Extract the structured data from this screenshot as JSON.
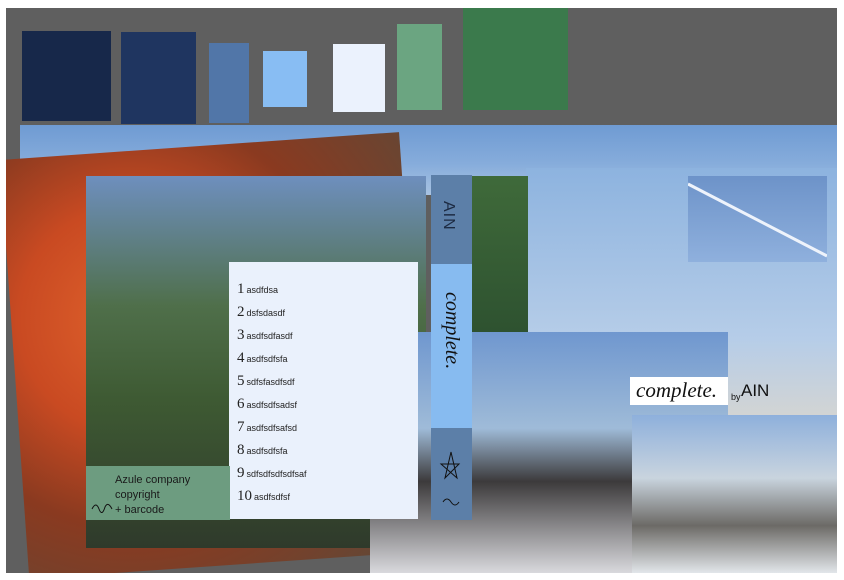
{
  "palette": {
    "swatches": [
      {
        "color": "#17284a"
      },
      {
        "color": "#1f3560"
      },
      {
        "color": "#5176a8"
      },
      {
        "color": "#88bdf3"
      },
      {
        "color": "#ebf2fd"
      },
      {
        "color": "#6ba581"
      },
      {
        "color": "#3b7a4c"
      }
    ]
  },
  "numbered_list": [
    {
      "num": "1",
      "text": "asdfdsa"
    },
    {
      "num": "2",
      "text": "dsfsdasdf"
    },
    {
      "num": "3",
      "text": "asdfsdfasdf"
    },
    {
      "num": "4",
      "text": "asdfsdfsfa"
    },
    {
      "num": "5",
      "text": "sdfsfasdfsdf"
    },
    {
      "num": "6",
      "text": "asdfsdfsadsf"
    },
    {
      "num": "7",
      "text": "asdfsdfsafsd"
    },
    {
      "num": "8",
      "text": "asdfsdfsfa"
    },
    {
      "num": "9",
      "text": "sdfsdfsdfsdfsaf"
    },
    {
      "num": "10",
      "text": "asdfsdfsf"
    }
  ],
  "spine": {
    "brand": "AIN",
    "title": "complete."
  },
  "cover": {
    "title": "complete.",
    "by": "by",
    "author": "AIN"
  },
  "company_block": {
    "lines": [
      "Azule company",
      "copyright",
      "+ barcode"
    ]
  },
  "colors": {
    "board_bg": "#5f5f5f",
    "list_bg": "#eaf1fc",
    "spine_dark": "#5c7fa8",
    "spine_light": "#87bbf0",
    "company_bg": "#6d9c80"
  }
}
